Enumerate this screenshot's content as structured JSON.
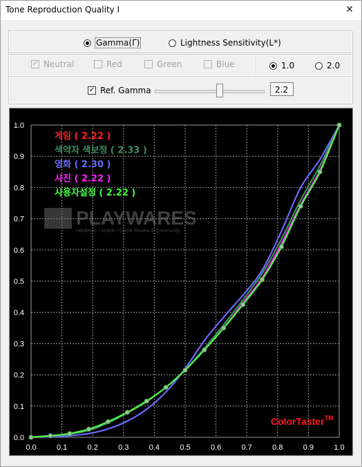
{
  "window": {
    "title": "Tone Reproduction Quality I",
    "close_glyph": "✕"
  },
  "mode": {
    "gamma_label": "Gamma(Γ)",
    "lightness_label": "Lightness Sensitivity(L*)",
    "selected": "gamma"
  },
  "channels": [
    {
      "label": "Neutral",
      "checked": true
    },
    {
      "label": "Red",
      "checked": false
    },
    {
      "label": "Green",
      "checked": false
    },
    {
      "label": "Blue",
      "checked": false
    }
  ],
  "scale": {
    "opt1": "1.0",
    "opt2": "2.0",
    "selected": "1.0"
  },
  "ref_gamma": {
    "label": "Ref. Gamma",
    "checked": true,
    "value": "2.2",
    "slider_fraction": 0.59
  },
  "watermark": {
    "brand": "PLAYWARES",
    "tagline": "Hardware / Mobile / Game Review & Community"
  },
  "colors": {
    "game": "#ff2020",
    "color_weakness": "#3f8f5f",
    "movie": "#6a6aff",
    "photo": "#ff20ff",
    "user": "#40ff40",
    "brand": "#ff1a1a"
  },
  "chart_data": {
    "type": "line",
    "xlim": [
      0,
      1
    ],
    "ylim": [
      0,
      1
    ],
    "xticks": [
      "0.0",
      "0.1",
      "0.2",
      "0.3",
      "0.4",
      "0.5",
      "0.6",
      "0.7",
      "0.8",
      "0.9",
      "1.0"
    ],
    "yticks": [
      "0.0",
      "0.1",
      "0.2",
      "0.3",
      "0.4",
      "0.5",
      "0.6",
      "0.7",
      "0.8",
      "0.9",
      "1.0"
    ],
    "grid": true,
    "legend_position": "top-left",
    "brand_label": "ColorTaster",
    "brand_tm": "TM",
    "series": [
      {
        "name": "게임 ( 2.22 )",
        "color": "#ff2020",
        "x": [
          0,
          0.0625,
          0.125,
          0.1875,
          0.25,
          0.3125,
          0.375,
          0.4375,
          0.5,
          0.5625,
          0.625,
          0.6875,
          0.75,
          0.8125,
          0.875,
          0.9375,
          1.0
        ],
        "y": [
          0,
          0.005,
          0.012,
          0.026,
          0.05,
          0.08,
          0.116,
          0.16,
          0.215,
          0.28,
          0.35,
          0.43,
          0.51,
          0.62,
          0.74,
          0.85,
          1.0
        ]
      },
      {
        "name": "색약자 색보정 ( 2.33 )",
        "color": "#3f8f5f",
        "x": [
          0,
          0.0625,
          0.125,
          0.1875,
          0.25,
          0.3125,
          0.375,
          0.4375,
          0.5,
          0.5625,
          0.625,
          0.6875,
          0.75,
          0.8125,
          0.875,
          0.9375,
          1.0
        ],
        "y": [
          0,
          0.004,
          0.01,
          0.022,
          0.046,
          0.078,
          0.114,
          0.16,
          0.215,
          0.285,
          0.36,
          0.44,
          0.525,
          0.635,
          0.76,
          0.87,
          1.0
        ]
      },
      {
        "name": "영화 ( 2.30 )",
        "color": "#6a6aff",
        "x": [
          0,
          0.0625,
          0.125,
          0.1875,
          0.25,
          0.3125,
          0.375,
          0.4375,
          0.5,
          0.5625,
          0.625,
          0.6875,
          0.75,
          0.8125,
          0.875,
          0.9375,
          1.0
        ],
        "y": [
          0,
          0.002,
          0.005,
          0.012,
          0.027,
          0.052,
          0.09,
          0.145,
          0.22,
          0.31,
          0.385,
          0.455,
          0.535,
          0.66,
          0.8,
          0.89,
          1.0
        ]
      },
      {
        "name": "사진 ( 2.22 )",
        "color": "#ff20ff",
        "x": [
          0,
          0.0625,
          0.125,
          0.1875,
          0.25,
          0.3125,
          0.375,
          0.4375,
          0.5,
          0.5625,
          0.625,
          0.6875,
          0.75,
          0.8125,
          0.875,
          0.9375,
          1.0
        ],
        "y": [
          0,
          0.005,
          0.012,
          0.026,
          0.05,
          0.08,
          0.116,
          0.16,
          0.215,
          0.28,
          0.35,
          0.43,
          0.51,
          0.62,
          0.745,
          0.855,
          1.0
        ]
      },
      {
        "name": "사용자설정 ( 2.22 )",
        "color": "#40ff40",
        "x": [
          0,
          0.0625,
          0.125,
          0.1875,
          0.25,
          0.3125,
          0.375,
          0.4375,
          0.5,
          0.5625,
          0.625,
          0.6875,
          0.75,
          0.8125,
          0.875,
          0.9375,
          1.0
        ],
        "y": [
          0,
          0.005,
          0.012,
          0.026,
          0.05,
          0.08,
          0.116,
          0.16,
          0.215,
          0.28,
          0.35,
          0.425,
          0.505,
          0.61,
          0.74,
          0.85,
          1.0
        ]
      }
    ]
  }
}
